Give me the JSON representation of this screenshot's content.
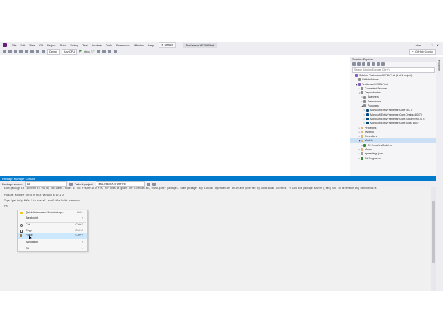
{
  "menubar": {
    "items": [
      "File",
      "Edit",
      "View",
      "Git",
      "Project",
      "Build",
      "Debug",
      "Test",
      "Analyze",
      "Tools",
      "Extensions",
      "Window",
      "Help"
    ],
    "search_label": "Search",
    "solution_name": "TestLessonXEFDbFirst",
    "user_initials": "chia"
  },
  "toolbar": {
    "config": "Debug",
    "platform": "Any CPU",
    "run_target": "https",
    "copilot_label": "GitHub Copilot"
  },
  "solution_explorer": {
    "title": "Solution Explorer",
    "search_placeholder": "Search Solution Explorer (Ctrl+;)",
    "nodes": [
      {
        "label": "Solution 'TestLessonXEFDbFirst' (1 of 1 project)",
        "depth": 0,
        "expand": ""
      },
      {
        "label": "GitHub Actions",
        "depth": 1,
        "expand": ""
      },
      {
        "label": "TestLessonXEFDbFirst",
        "depth": 1,
        "expand": "open"
      },
      {
        "label": "Connected Services",
        "depth": 2,
        "expand": "closed"
      },
      {
        "label": "Dependencies",
        "depth": 2,
        "expand": "open"
      },
      {
        "label": "Analyzers",
        "depth": 3,
        "expand": "closed"
      },
      {
        "label": "Frameworks",
        "depth": 3,
        "expand": "closed"
      },
      {
        "label": "Packages",
        "depth": 3,
        "expand": "open"
      },
      {
        "label": "Microsoft.EntityFrameworkCore (8.0.7)",
        "depth": 4,
        "expand": "closed"
      },
      {
        "label": "Microsoft.EntityFrameworkCore.Design (8.0.7)",
        "depth": 4,
        "expand": "closed"
      },
      {
        "label": "Microsoft.EntityFrameworkCore.SqlServer (8.0.7)",
        "depth": 4,
        "expand": "closed"
      },
      {
        "label": "Microsoft.EntityFrameworkCore.Tools (8.0.7)",
        "depth": 4,
        "expand": "closed"
      },
      {
        "label": "Properties",
        "depth": 2,
        "expand": "closed"
      },
      {
        "label": "wwwroot",
        "depth": 2,
        "expand": "closed"
      },
      {
        "label": "Controllers",
        "depth": 2,
        "expand": "closed"
      },
      {
        "label": "Models",
        "depth": 2,
        "expand": "open",
        "selected": true
      },
      {
        "label": "C# ErrorViewModel.cs",
        "depth": 3,
        "expand": "closed"
      },
      {
        "label": "Views",
        "depth": 2,
        "expand": "closed"
      },
      {
        "label": "appsettings.json",
        "depth": 2,
        "expand": "closed"
      },
      {
        "label": "C# Program.cs",
        "depth": 2,
        "expand": "closed"
      }
    ]
  },
  "right_tabs": [
    "Properties"
  ],
  "pmc": {
    "title": "Package Manager Console",
    "source_label": "Package source:",
    "source_value": "All",
    "project_label": "Default project:",
    "project_value": "TestLessonXEFDbFirst",
    "lines": [
      "Each package is licensed to you by its owner. NuGet is not responsible for, nor does it grant any licenses to, third-party packages. Some packages may include dependencies which are governed by additional licenses. Follow the package source (feed) URL to determine any dependencies.",
      "Package Manager Console Host Version 6.10.1.2",
      "Type 'get-help NuGet' to see all available NuGet commands.",
      "PM>"
    ]
  },
  "context_menu": {
    "items": [
      {
        "label": "Quick Actions and Refactorings...",
        "shortcut": "Ctrl+.",
        "icon": "lightbulb-icon"
      },
      {
        "label": "Breakpoint",
        "shortcut": "",
        "icon": "",
        "submenu": true
      },
      {
        "label": "Cut",
        "shortcut": "Ctrl+X",
        "icon": "scissors-icon"
      },
      {
        "label": "Copy",
        "shortcut": "Ctrl+C",
        "icon": "copy-icon"
      },
      {
        "label": "Paste",
        "shortcut": "Ctrl+V",
        "icon": "paste-icon",
        "highlighted": true
      },
      {
        "label": "Annotation",
        "shortcut": "",
        "icon": "",
        "submenu": true
      },
      {
        "label": "Git",
        "shortcut": "",
        "icon": "",
        "submenu": true
      }
    ]
  },
  "colors": {
    "accent": "#007acc",
    "vs_purple": "#68217a",
    "selection": "#cce0f5"
  }
}
